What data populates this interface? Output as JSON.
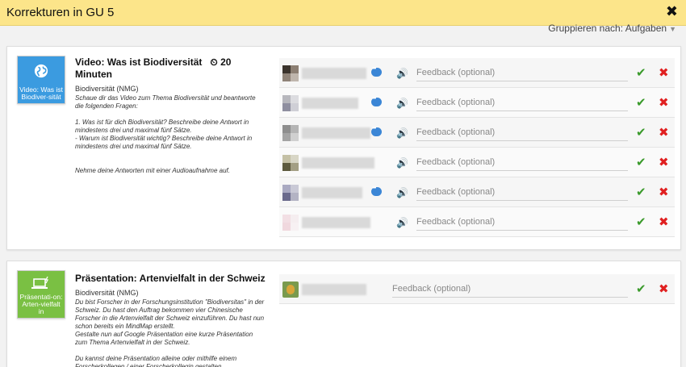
{
  "header": {
    "title": "Korrekturen in GU 5",
    "close_icon": "close-icon"
  },
  "group_by": {
    "label": "Gruppieren nach: Aufgaben"
  },
  "tasks": [
    {
      "thumb_label": "Video: Was ist Biodiver-sität",
      "thumb_icon": "globe-icon",
      "title": "Video: Was ist Biodiversität",
      "duration": "20 Minuten",
      "subject": "Biodiversität (NMG)",
      "description": [
        "Schaue dir das Video zum Thema Biodiversität und beantworte die folgenden Fragen:",
        "",
        "1. Was ist für dich Biodiversität? Beschreibe deine Antwort in mindestens drei und maximal fünf Sätze.",
        "- Warum ist Biodiversität wichtig? Beschreibe deine Antwort in mindestens drei und maximal fünf Sätze.",
        "",
        "",
        "Nehme deine Antworten mit einer Audioaufnahme auf."
      ],
      "submissions": [
        {
          "feedback_placeholder": "Feedback (optional)",
          "has_chat": true
        },
        {
          "feedback_placeholder": "Feedback (optional)",
          "has_chat": true
        },
        {
          "feedback_placeholder": "Feedback (optional)",
          "has_chat": true
        },
        {
          "feedback_placeholder": "Feedback (optional)",
          "has_chat": false
        },
        {
          "feedback_placeholder": "Feedback (optional)",
          "has_chat": true
        },
        {
          "feedback_placeholder": "Feedback (optional)",
          "has_chat": false
        }
      ]
    },
    {
      "thumb_label": "Präsentati-on: Arten-vielfalt in",
      "thumb_icon": "laptop-icon",
      "title": "Präsentation: Artenvielfalt in der Schweiz",
      "subject": "Biodiversität (NMG)",
      "description": [
        "Du bist Forscher in der Forschungsinstitution \"Biodiversitas\" in der Schweiz. Du hast den Auftrag bekommen vier Chinesische Forscher in die Artenvielfalt der Schweiz einzuführen. Du hast nun schon bereits ein MindMap erstellt.",
        "Gestalte nun auf Google Präsentation eine kurze Präsentation zum Thema Artenvielfalt in der Schweiz.",
        "",
        "Du kannst deine Präsentation alleine oder mithilfe einem Forscherkollegen / einer Forscherkollegin gestalten."
      ],
      "submissions": [
        {
          "feedback_placeholder": "Feedback (optional)"
        }
      ]
    }
  ],
  "colors": {
    "header_bg": "#fce58a",
    "accept": "#3a9a2b",
    "reject": "#e02020",
    "thumb_video": "#3b9be0",
    "thumb_presentation": "#7ac043"
  }
}
